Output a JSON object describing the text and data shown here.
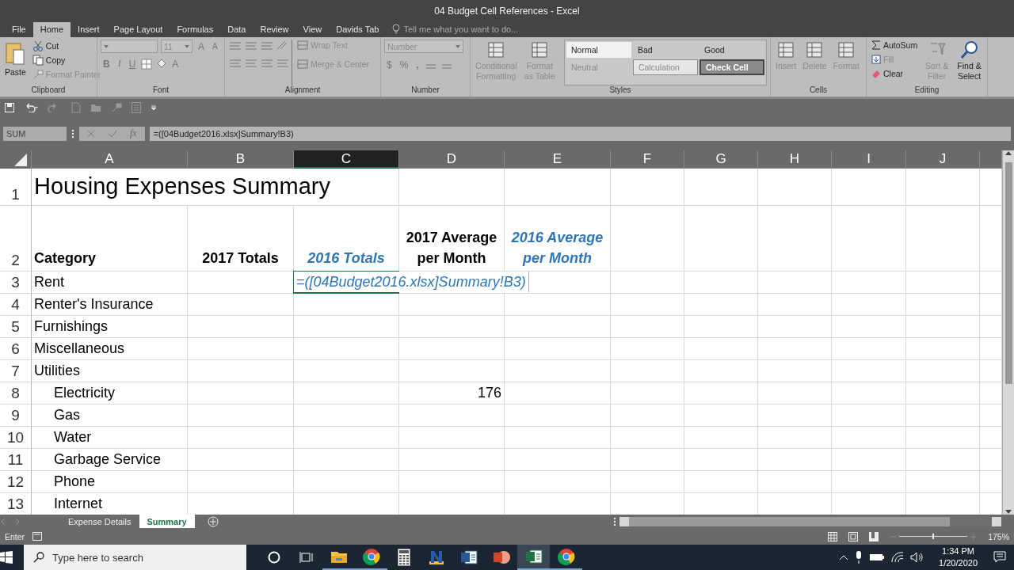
{
  "window": {
    "title": "04 Budget Cell References - Excel"
  },
  "tabs": [
    {
      "label": "File",
      "selected": false
    },
    {
      "label": "Home",
      "selected": true
    },
    {
      "label": "Insert",
      "selected": false
    },
    {
      "label": "Page Layout",
      "selected": false
    },
    {
      "label": "Formulas",
      "selected": false
    },
    {
      "label": "Data",
      "selected": false
    },
    {
      "label": "Review",
      "selected": false
    },
    {
      "label": "View",
      "selected": false
    },
    {
      "label": "Davids Tab",
      "selected": false
    }
  ],
  "tell_me": {
    "placeholder": "Tell me what you want to do..."
  },
  "ribbon": {
    "clipboard": {
      "label": "Clipboard",
      "paste": {
        "label": "Paste",
        "disabled": false
      },
      "commands": [
        {
          "label": "Cut",
          "disabled": false
        },
        {
          "label": "Copy",
          "disabled": false
        },
        {
          "label": "Format Painter",
          "disabled": true
        }
      ]
    },
    "font": {
      "label": "Font",
      "size": "11",
      "grow": "A",
      "shrink": "A",
      "bold": "B",
      "italic": "I",
      "underline": "U",
      "font_color": "A"
    },
    "alignment": {
      "label": "Alignment",
      "commands": [
        {
          "label": "Wrap Text",
          "disabled": true
        },
        {
          "label": "Merge & Center",
          "disabled": true
        }
      ]
    },
    "number": {
      "label": "Number",
      "format": "Number",
      "currency": "$",
      "percent": "%",
      "comma": ","
    },
    "styles": {
      "label": "Styles",
      "commands": [
        {
          "label": "Conditional Formatting",
          "disabled": true
        },
        {
          "label": "Format as Table",
          "disabled": true
        }
      ],
      "cell_styles": [
        {
          "label": "Normal",
          "kind": "normal",
          "disabled": false
        },
        {
          "label": "Bad",
          "kind": "plain",
          "disabled": false
        },
        {
          "label": "Good",
          "kind": "plain",
          "disabled": false
        },
        {
          "label": "Neutral",
          "kind": "plain",
          "disabled": true
        },
        {
          "label": "Calculation",
          "kind": "calculation",
          "disabled": true
        },
        {
          "label": "Check Cell",
          "kind": "check",
          "disabled": false
        }
      ]
    },
    "cells": {
      "label": "Cells",
      "commands": [
        {
          "label": "Insert",
          "disabled": true
        },
        {
          "label": "Delete",
          "disabled": true
        },
        {
          "label": "Format",
          "disabled": true
        }
      ]
    },
    "editing": {
      "label": "Editing",
      "commands": [
        {
          "label": "AutoSum",
          "disabled": false
        },
        {
          "label": "Fill",
          "disabled": true
        },
        {
          "label": "Clear",
          "disabled": false
        },
        {
          "label": "Sort & Filter",
          "disabled": true
        },
        {
          "label": "Find & Select",
          "disabled": false
        }
      ]
    }
  },
  "formula_bar": {
    "name_box": "SUM",
    "function_label": "fx",
    "formula": "=([04Budget2016.xlsx]Summary!B3)"
  },
  "columns": [
    {
      "label": "A",
      "selected": false
    },
    {
      "label": "B",
      "selected": false
    },
    {
      "label": "C",
      "selected": true
    },
    {
      "label": "D",
      "selected": false
    },
    {
      "label": "E",
      "selected": false
    },
    {
      "label": "F",
      "selected": false
    },
    {
      "label": "G",
      "selected": false
    },
    {
      "label": "H",
      "selected": false
    },
    {
      "label": "I",
      "selected": false
    },
    {
      "label": "J",
      "selected": false
    }
  ],
  "rows": [
    {
      "number": "1",
      "cells": {
        "a": {
          "text": "Housing Expenses Summary",
          "kind": "title"
        }
      }
    },
    {
      "number": "2",
      "cells": {
        "a": {
          "text": "Category",
          "kind": "header"
        },
        "b": {
          "text": "2017 Totals",
          "kind": "header"
        },
        "c": {
          "text": "2016 Totals",
          "kind": "linked_header"
        },
        "d": {
          "text": "2017 Average per Month",
          "kind": "header"
        },
        "e": {
          "text": "2016 Average per Month",
          "kind": "linked_header"
        }
      }
    },
    {
      "number": "3",
      "cells": {
        "a": {
          "text": "Rent",
          "kind": "label"
        },
        "c": {
          "text": "=([04Budget2016.xlsx]Summary!B3)",
          "kind": "editing"
        }
      }
    },
    {
      "number": "4",
      "cells": {
        "a": {
          "text": "Renter's Insurance",
          "kind": "label"
        }
      }
    },
    {
      "number": "5",
      "cells": {
        "a": {
          "text": "Furnishings",
          "kind": "label"
        }
      }
    },
    {
      "number": "6",
      "cells": {
        "a": {
          "text": "Miscellaneous",
          "kind": "label"
        }
      }
    },
    {
      "number": "7",
      "cells": {
        "a": {
          "text": "Utilities",
          "kind": "label"
        }
      }
    },
    {
      "number": "8",
      "cells": {
        "a": {
          "text": "Electricity",
          "kind": "sublabel"
        },
        "d": {
          "text": "176",
          "kind": "number"
        }
      }
    },
    {
      "number": "9",
      "cells": {
        "a": {
          "text": "Gas",
          "kind": "sublabel"
        }
      }
    },
    {
      "number": "10",
      "cells": {
        "a": {
          "text": "Water",
          "kind": "sublabel"
        }
      }
    },
    {
      "number": "11",
      "cells": {
        "a": {
          "text": "Garbage Service",
          "kind": "sublabel"
        }
      }
    },
    {
      "number": "12",
      "cells": {
        "a": {
          "text": "Phone",
          "kind": "sublabel"
        }
      }
    },
    {
      "number": "13",
      "cells": {
        "a": {
          "text": "Internet",
          "kind": "sublabel"
        }
      }
    }
  ],
  "sheet_tabs": [
    {
      "label": "Expense Details",
      "selected": false
    },
    {
      "label": "Summary",
      "selected": true
    }
  ],
  "status_bar": {
    "mode": "Enter",
    "zoom_slider": {
      "level": 0.5
    },
    "zoom": "175%"
  },
  "taskbar": {
    "search": {
      "placeholder": "Type here to search"
    },
    "apps": [
      {
        "kind": "folder",
        "running": true,
        "selected": false
      },
      {
        "kind": "browser",
        "running": true,
        "selected": false
      },
      {
        "kind": "calculator",
        "running": false,
        "selected": false
      },
      {
        "kind": "news",
        "running": false,
        "selected": false
      },
      {
        "kind": "word",
        "running": false,
        "selected": false
      },
      {
        "kind": "slides",
        "running": false,
        "selected": false
      },
      {
        "kind": "sheet",
        "running": true,
        "selected": true
      },
      {
        "kind": "browser",
        "running": true,
        "selected": false
      }
    ],
    "time": "1:34 PM",
    "date": "1/20/2020"
  }
}
